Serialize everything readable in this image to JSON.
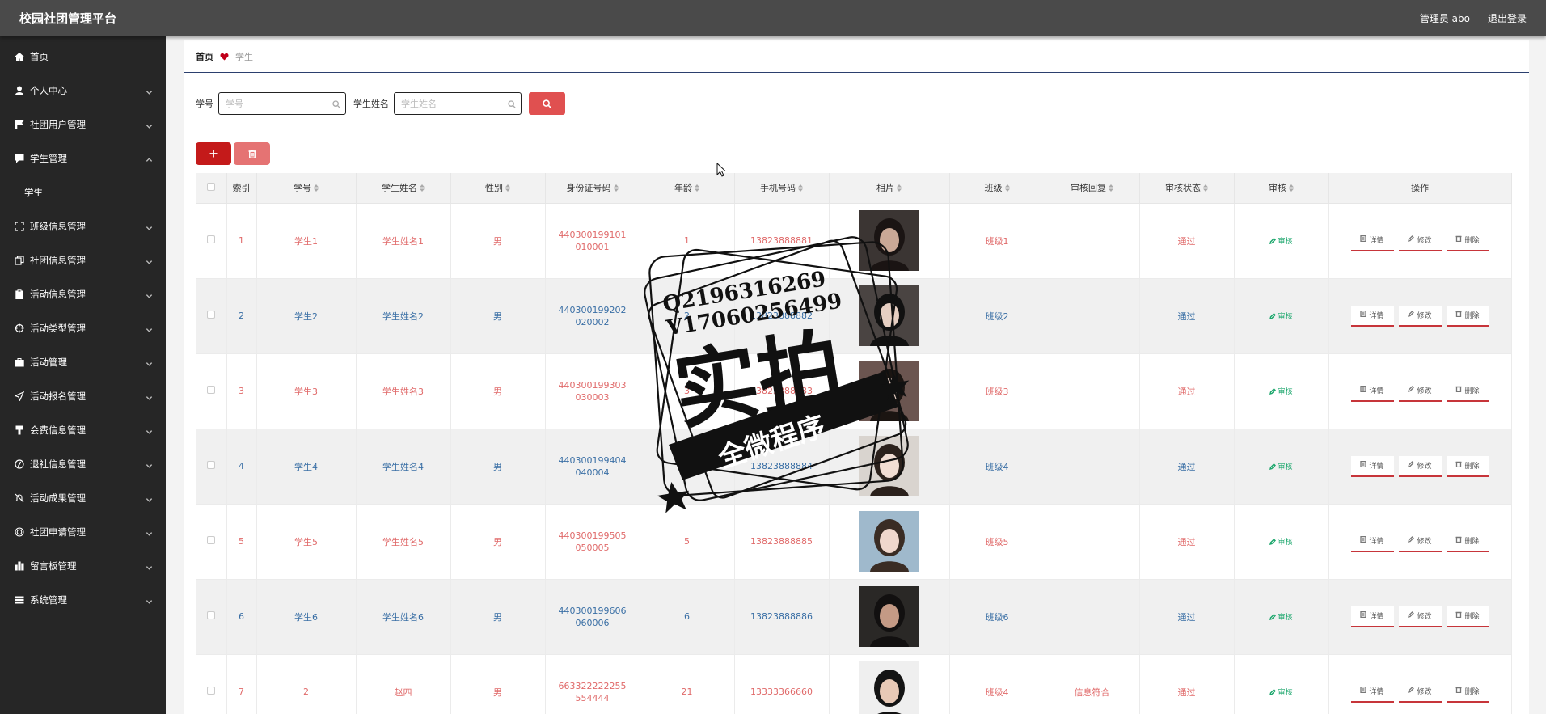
{
  "app": {
    "title": "校园社团管理平台",
    "user_label": "管理员 abo",
    "logout_label": "退出登录"
  },
  "sidebar": {
    "items": [
      {
        "label": "首页",
        "icon": "home-icon",
        "has_chevron": false
      },
      {
        "label": "个人中心",
        "icon": "user-icon",
        "has_chevron": true
      },
      {
        "label": "社团用户管理",
        "icon": "flag-icon",
        "has_chevron": true
      },
      {
        "label": "学生管理",
        "icon": "chat-icon",
        "has_chevron": true,
        "expanded": true
      },
      {
        "label": "学生",
        "icon": "",
        "has_chevron": false,
        "sub": true
      },
      {
        "label": "班级信息管理",
        "icon": "expand-icon",
        "has_chevron": true
      },
      {
        "label": "社团信息管理",
        "icon": "copy-icon",
        "has_chevron": true
      },
      {
        "label": "活动信息管理",
        "icon": "clipboard-icon",
        "has_chevron": true
      },
      {
        "label": "活动类型管理",
        "icon": "crosshair-icon",
        "has_chevron": true
      },
      {
        "label": "活动管理",
        "icon": "briefcase-icon",
        "has_chevron": true
      },
      {
        "label": "活动报名管理",
        "icon": "send-icon",
        "has_chevron": true
      },
      {
        "label": "会费信息管理",
        "icon": "stamp-icon",
        "has_chevron": true
      },
      {
        "label": "退社信息管理",
        "icon": "compass-icon",
        "has_chevron": true
      },
      {
        "label": "活动成果管理",
        "icon": "bell-off-icon",
        "has_chevron": true
      },
      {
        "label": "社团申请管理",
        "icon": "target-icon",
        "has_chevron": true
      },
      {
        "label": "留言板管理",
        "icon": "bar-chart-icon",
        "has_chevron": true
      },
      {
        "label": "系统管理",
        "icon": "menu-icon",
        "has_chevron": true
      }
    ]
  },
  "breadcrumb": {
    "home": "首页",
    "current": "学生"
  },
  "search": {
    "student_no_label": "学号",
    "student_no_placeholder": "学号",
    "student_name_label": "学生姓名",
    "student_name_placeholder": "学生姓名"
  },
  "table": {
    "columns": [
      "索引",
      "学号",
      "学生姓名",
      "性别",
      "身份证号码",
      "年龄",
      "手机号码",
      "相片",
      "班级",
      "审核回复",
      "审核状态",
      "审核",
      "操作"
    ],
    "audit_label": "审核",
    "op_labels": {
      "detail": "详情",
      "edit": "修改",
      "delete": "删除"
    },
    "rows": [
      {
        "index": "1",
        "student_no": "学生1",
        "name": "学生姓名1",
        "gender": "男",
        "id_card": "440300199101010001",
        "age": "1",
        "phone": "13823888881",
        "class": "班级1",
        "reply": "",
        "status": "通过"
      },
      {
        "index": "2",
        "student_no": "学生2",
        "name": "学生姓名2",
        "gender": "男",
        "id_card": "440300199202020002",
        "age": "2",
        "phone": "13823888882",
        "class": "班级2",
        "reply": "",
        "status": "通过"
      },
      {
        "index": "3",
        "student_no": "学生3",
        "name": "学生姓名3",
        "gender": "男",
        "id_card": "440300199303030003",
        "age": "3",
        "phone": "13823888883",
        "class": "班级3",
        "reply": "",
        "status": "通过"
      },
      {
        "index": "4",
        "student_no": "学生4",
        "name": "学生姓名4",
        "gender": "男",
        "id_card": "440300199404040004",
        "age": "4",
        "phone": "13823888884",
        "class": "班级4",
        "reply": "",
        "status": "通过"
      },
      {
        "index": "5",
        "student_no": "学生5",
        "name": "学生姓名5",
        "gender": "男",
        "id_card": "440300199505050005",
        "age": "5",
        "phone": "13823888885",
        "class": "班级5",
        "reply": "",
        "status": "通过"
      },
      {
        "index": "6",
        "student_no": "学生6",
        "name": "学生姓名6",
        "gender": "男",
        "id_card": "440300199606060006",
        "age": "6",
        "phone": "13823888886",
        "class": "班级6",
        "reply": "",
        "status": "通过"
      },
      {
        "index": "7",
        "student_no": "2",
        "name": "赵四",
        "gender": "男",
        "id_card": "663322222255554444",
        "age": "21",
        "phone": "13333366660",
        "class": "班级4",
        "reply": "信息符合",
        "status": "通过"
      }
    ]
  },
  "watermark": {
    "line1": "Q2196316269",
    "line2": "V17060256499",
    "big": "实拍",
    "ribbon": "全微程序"
  },
  "colors": {
    "accent": "#c41a1a",
    "odd_text": "#e06a6a",
    "even_text": "#3a6fa5",
    "audit": "#1aa66b",
    "sidebar_bg": "#262626",
    "topbar_bg": "#4a4a4a"
  }
}
